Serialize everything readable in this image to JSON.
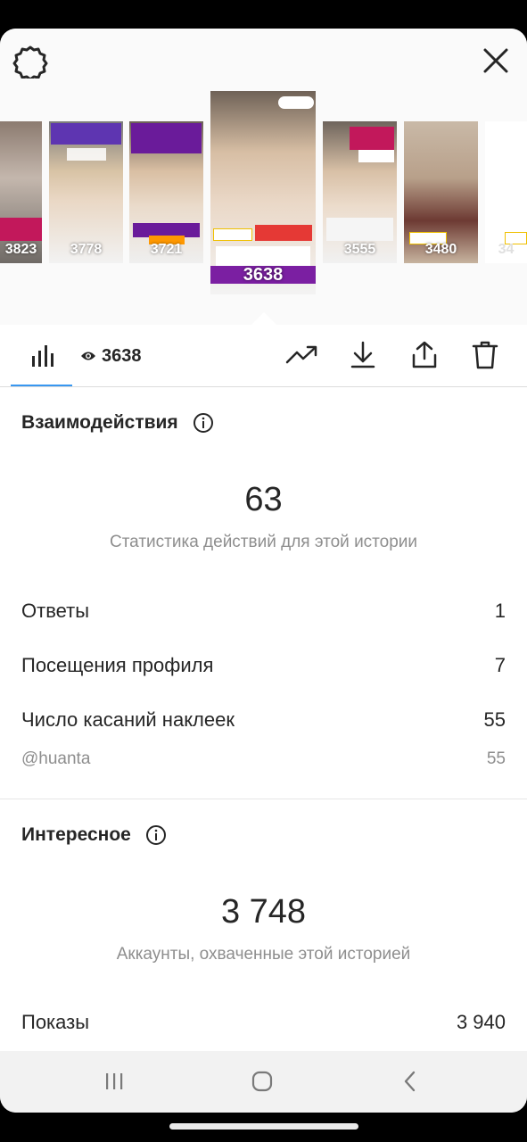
{
  "header": {
    "settings_icon": "gear-icon",
    "close_icon": "close-icon"
  },
  "stories": [
    {
      "views": "3823"
    },
    {
      "views": "3778"
    },
    {
      "views": "3721"
    },
    {
      "views": "3638",
      "selected": true
    },
    {
      "views": "3555"
    },
    {
      "views": "3480"
    },
    {
      "views": "34"
    }
  ],
  "tabs": {
    "stats_icon": "bar-chart-icon",
    "views_count": "3638",
    "tools": [
      "trending-up-icon",
      "download-icon",
      "share-icon",
      "trash-icon"
    ]
  },
  "interactions": {
    "title": "Взаимодействия",
    "total": "63",
    "caption": "Статистика действий для этой истории",
    "rows": [
      {
        "label": "Ответы",
        "value": "1"
      },
      {
        "label": "Посещения профиля",
        "value": "7"
      },
      {
        "label": "Число касаний наклеек",
        "value": "55"
      }
    ],
    "sticker": {
      "label": "@huanta",
      "value": "55"
    }
  },
  "discovery": {
    "title": "Интересное",
    "total": "3 748",
    "caption": "Аккаунты, охваченные этой историей",
    "rows": [
      {
        "label": "Показы",
        "value": "3 940"
      }
    ]
  },
  "colors": {
    "accent": "#3897f0",
    "text": "#262626",
    "muted": "#8e8e8e"
  }
}
